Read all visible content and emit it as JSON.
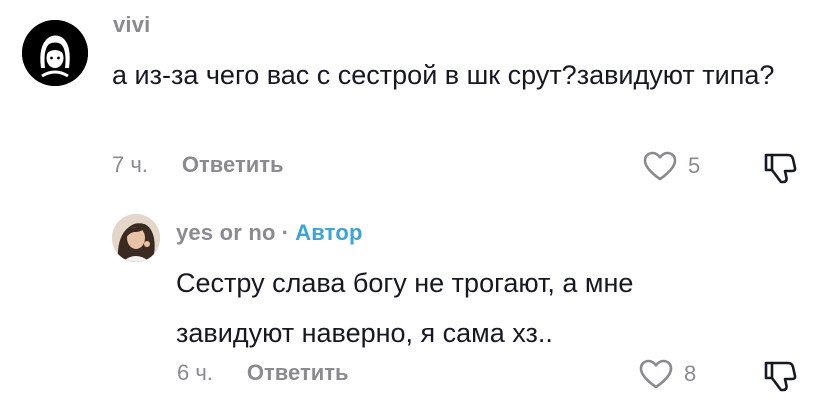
{
  "comments": [
    {
      "author": "vivi",
      "text": "а из-за чего вас с сестрой в шк срут?завидуют типа?",
      "time": "7 ч.",
      "reply_label": "Ответить",
      "likes": "5"
    },
    {
      "author": "yes or no",
      "separator": "·",
      "badge": "Автор",
      "text": "Сестру слава богу не трогают, а мне завидуют наверно, я сама хз..",
      "time": "6 ч.",
      "reply_label": "Ответить",
      "likes": "8"
    }
  ],
  "icons": {
    "like": "heart-outline-icon",
    "dislike": "thumbs-down-icon"
  },
  "colors": {
    "text": "#161823",
    "muted": "#8a8b91",
    "author_badge": "#3ea3d7"
  }
}
